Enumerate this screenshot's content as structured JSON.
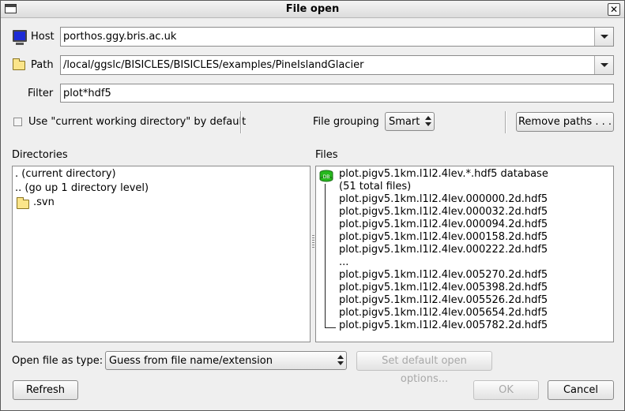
{
  "window": {
    "title": "File open"
  },
  "host": {
    "label": "Host",
    "value": "porthos.ggy.bris.ac.uk"
  },
  "path": {
    "label": "Path",
    "value": "/local/ggslc/BISICLES/BISICLES/examples/PineIslandGlacier"
  },
  "filter": {
    "label": "Filter",
    "value": "plot*hdf5"
  },
  "options": {
    "use_cwd_label": "Use \"current working directory\" by default",
    "file_grouping_label": "File grouping",
    "file_grouping_value": "Smart",
    "remove_paths_label": "Remove paths . . ."
  },
  "directories": {
    "header": "Directories",
    "items": [
      ". (current directory)",
      ".. (go up 1 directory level)",
      ".svn"
    ]
  },
  "files": {
    "header": "Files",
    "database_name": "plot.pigv5.1km.l1l2.4lev.*.hdf5 database",
    "total_label": "(51 total files)",
    "db_icon_text": "DB",
    "items": [
      "plot.pigv5.1km.l1l2.4lev.000000.2d.hdf5",
      "plot.pigv5.1km.l1l2.4lev.000032.2d.hdf5",
      "plot.pigv5.1km.l1l2.4lev.000094.2d.hdf5",
      "plot.pigv5.1km.l1l2.4lev.000158.2d.hdf5",
      "plot.pigv5.1km.l1l2.4lev.000222.2d.hdf5",
      "...",
      "plot.pigv5.1km.l1l2.4lev.005270.2d.hdf5",
      "plot.pigv5.1km.l1l2.4lev.005398.2d.hdf5",
      "plot.pigv5.1km.l1l2.4lev.005526.2d.hdf5",
      "plot.pigv5.1km.l1l2.4lev.005654.2d.hdf5",
      "plot.pigv5.1km.l1l2.4lev.005782.2d.hdf5"
    ]
  },
  "open_as": {
    "label": "Open file as type:",
    "value": "Guess from file name/extension",
    "default_options_label": "Set default open options..."
  },
  "buttons": {
    "refresh": "Refresh",
    "ok": "OK",
    "cancel": "Cancel"
  },
  "colors": {
    "db_icon": "#27b81e",
    "monitor": "#1c2bd6",
    "folder": "#fbe58a"
  }
}
